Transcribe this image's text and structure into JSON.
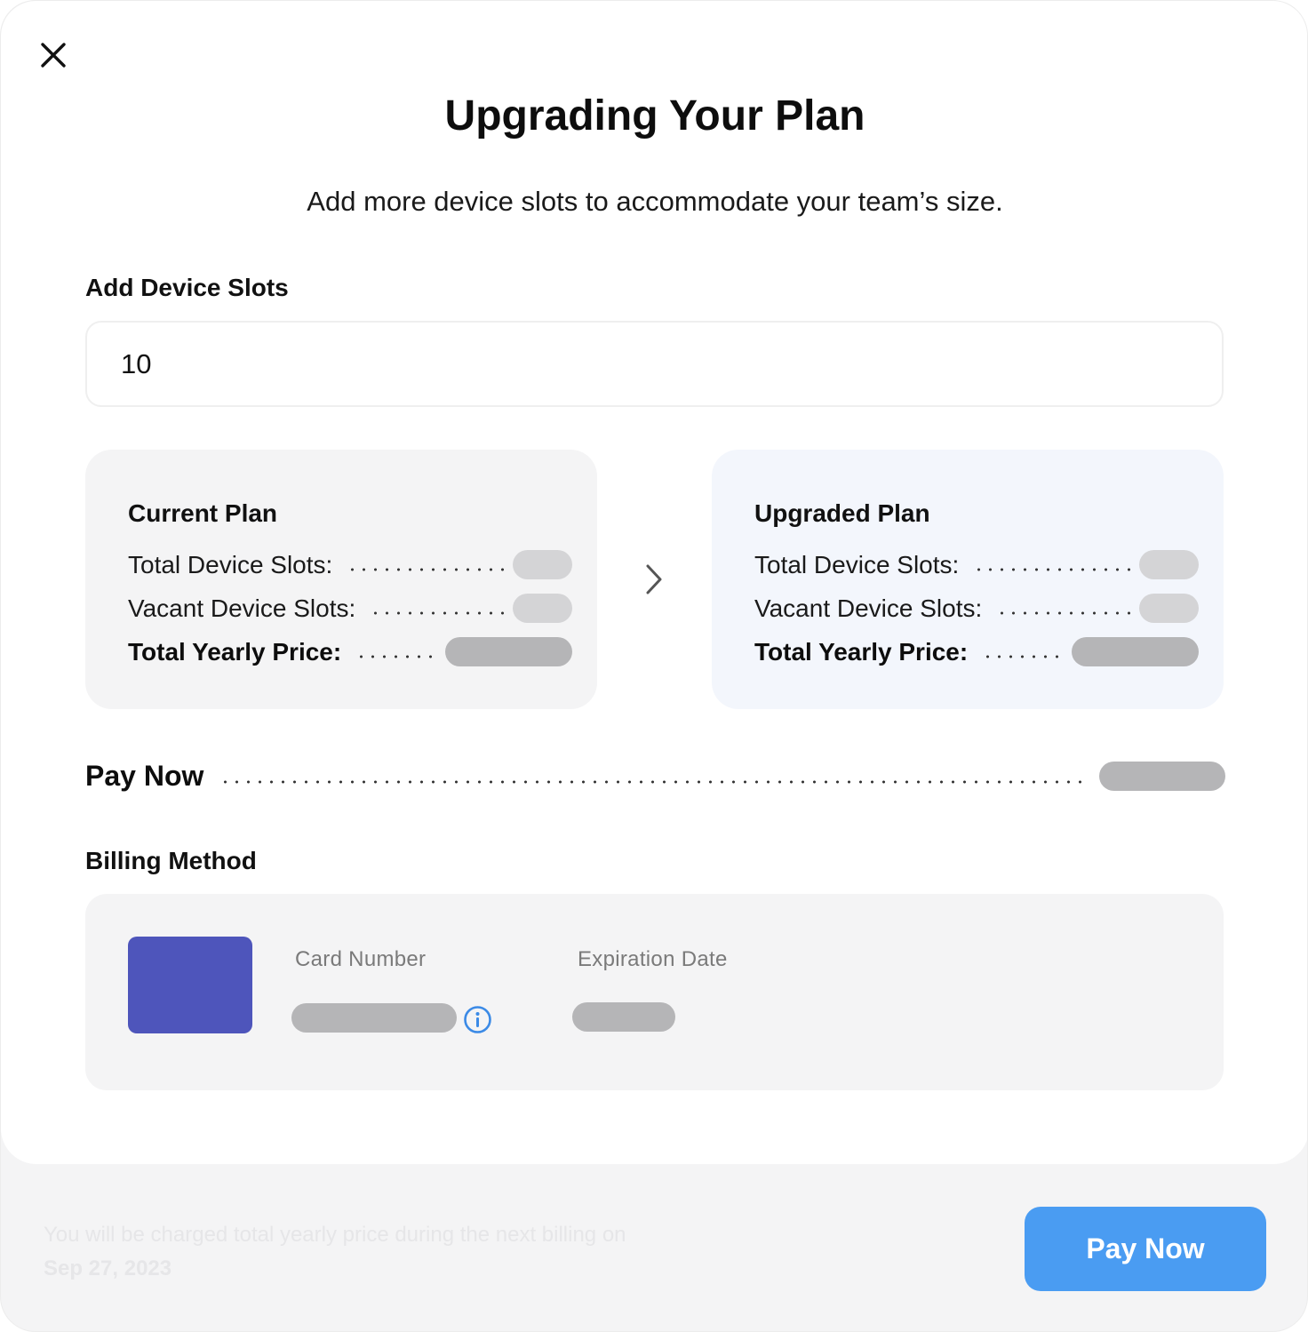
{
  "header": {
    "title": "Upgrading Your Plan",
    "subtitle": "Add more device slots to accommodate your team’s size."
  },
  "slots": {
    "label": "Add Device Slots",
    "value": "10"
  },
  "current_plan": {
    "title": "Current Plan",
    "total_slots_label": "Total Device Slots:",
    "vacant_slots_label": "Vacant Device Slots:",
    "price_label": "Total Yearly Price:"
  },
  "upgraded_plan": {
    "title": "Upgraded Plan",
    "total_slots_label": "Total Device Slots:",
    "vacant_slots_label": "Vacant Device Slots:",
    "price_label": "Total Yearly Price:"
  },
  "pay_now_row": {
    "label": "Pay Now"
  },
  "billing": {
    "label": "Billing Method",
    "card_number_label": "Card Number",
    "expiration_label": "Expiration Date"
  },
  "footer": {
    "note_prefix": "You will be charged total yearly price during the next billing on",
    "note_date": "Sep 27, 2023",
    "pay_button": "Pay Now"
  },
  "colors": {
    "accent": "#4a9cf2",
    "card_brand": "#4e55bb",
    "info": "#3b8ae6",
    "placeholder_light": "#d4d4d6",
    "placeholder_dark": "#b5b5b7"
  },
  "icons": {
    "close": "close-icon",
    "arrow": "chevron-right-icon",
    "info": "info-icon"
  }
}
